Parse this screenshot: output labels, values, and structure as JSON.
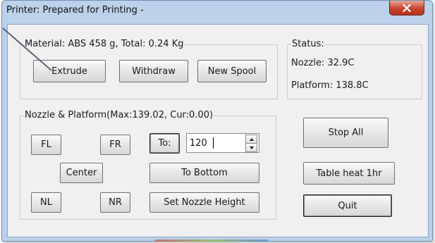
{
  "window": {
    "title": "Printer: Prepared for Printing -"
  },
  "material_group": {
    "legend": "Material: ABS 458 g,  Total: 0.24 Kg",
    "buttons": {
      "extrude": "Extrude",
      "withdraw": "Withdraw",
      "new_spool": "New Spool"
    }
  },
  "status_group": {
    "legend": "Status:",
    "nozzle": "Nozzle: 32.9C",
    "platform": "Platform: 138.8C"
  },
  "nozzle_group": {
    "legend": "Nozzle & Platform(Max:139.02, Cur:0.00)",
    "buttons": {
      "fl": "FL",
      "fr": "FR",
      "center": "Center",
      "nl": "NL",
      "nr": "NR",
      "to": "To:",
      "to_bottom": "To Bottom",
      "set_nozzle_height": "Set Nozzle Height"
    },
    "to_value": "120"
  },
  "right_buttons": {
    "stop_all": "Stop All",
    "table_heat": "Table heat 1hr",
    "quit": "Quit"
  },
  "icons": {
    "close": "close-icon",
    "spin_up": "arrow-up-icon",
    "spin_down": "arrow-down-icon",
    "cursor": "mouse-pointer-icon"
  },
  "colors": {
    "close_button": "#c7452f",
    "title_bar": "#bcd1ea",
    "dialog_bg": "#f0f0f0"
  }
}
